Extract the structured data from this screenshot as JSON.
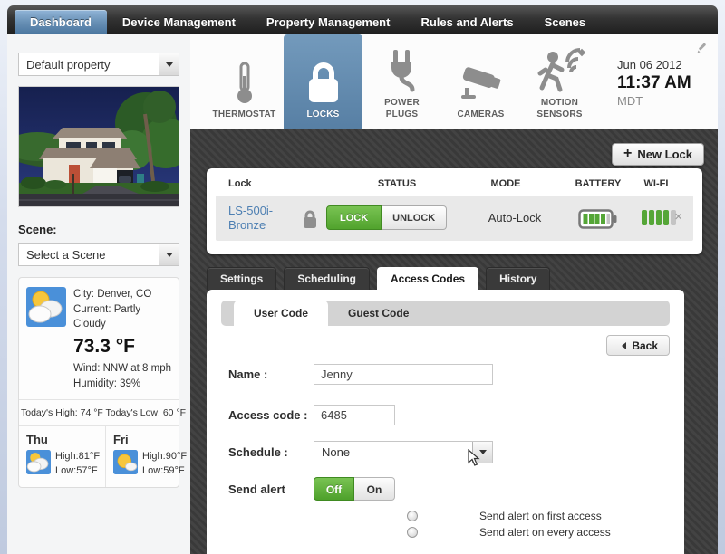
{
  "nav": {
    "items": [
      {
        "label": "Dashboard"
      },
      {
        "label": "Device Management"
      },
      {
        "label": "Property Management"
      },
      {
        "label": "Rules and Alerts"
      },
      {
        "label": "Scenes"
      }
    ],
    "active": "Dashboard"
  },
  "sidebar": {
    "property_select": {
      "value": "Default property"
    },
    "scene": {
      "label": "Scene:",
      "select_value": "Select a Scene"
    },
    "weather": {
      "city": "City: Denver, CO",
      "current": "Current: Partly Cloudy",
      "temperature": "73.3 °F",
      "wind": "Wind: NNW at 8 mph",
      "humidity": "Humidity: 39%",
      "today_range": "Today's High: 74 °F Today's Low: 60 °F",
      "forecast": [
        {
          "day": "Thu",
          "high": "High:81°F",
          "low": "Low:57°F"
        },
        {
          "day": "Fri",
          "high": "High:90°F",
          "low": "Low:59°F"
        }
      ]
    }
  },
  "device_bar": {
    "tabs": [
      {
        "label": "THERMOSTAT"
      },
      {
        "label": "LOCKS"
      },
      {
        "label": "POWER PLUGS"
      },
      {
        "label": "CAMERAS"
      },
      {
        "label": "MOTION SENSORS"
      }
    ],
    "active_tab": "LOCKS",
    "datetime": {
      "date": "Jun 06 2012",
      "time": "11:37 AM",
      "timezone": "MDT"
    }
  },
  "locks_panel": {
    "new_lock_button": "New Lock",
    "headers": {
      "lock": "Lock",
      "status": "STATUS",
      "mode": "MODE",
      "battery": "BATTERY",
      "wifi": "WI-FI"
    },
    "row": {
      "name": "LS-500i-Bronze",
      "lock_button": "LOCK",
      "unlock_button": "UNLOCK",
      "mode": "Auto-Lock",
      "battery_level": "4 of 5 bars",
      "wifi_level": "4 of 5 bars",
      "close": "×"
    }
  },
  "detail_tabs": [
    {
      "label": "Settings"
    },
    {
      "label": "Scheduling"
    },
    {
      "label": "Access Codes"
    },
    {
      "label": "History"
    }
  ],
  "access_codes": {
    "active_tab": "Access Codes",
    "subtabs": [
      {
        "label": "User Code"
      },
      {
        "label": "Guest Code"
      }
    ],
    "active_subtab": "User Code",
    "back_button": "Back",
    "form": {
      "name_label": "Name :",
      "name_value": "Jenny",
      "access_code_label": "Access code :",
      "access_code_value": "6485",
      "schedule_label": "Schedule :",
      "schedule_value": "None",
      "send_alert_label": "Send alert",
      "toggle_off": "Off",
      "toggle_on": "On",
      "radio_first": "Send alert on first access",
      "radio_every": "Send alert on every access"
    }
  },
  "colors": {
    "accent_blue": "#577fa4",
    "action_green": "#51a32d",
    "link_blue": "#4d7fb2",
    "dark_background": "#3e3e3e"
  }
}
